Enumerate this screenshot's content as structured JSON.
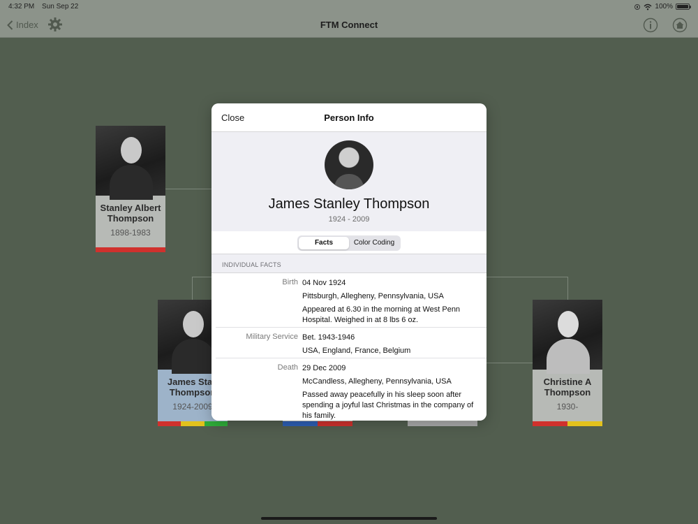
{
  "status": {
    "time": "4:32 PM",
    "date": "Sun Sep 22",
    "battery": "100%"
  },
  "nav": {
    "back_label": "Index",
    "title": "FTM Connect"
  },
  "cards": [
    {
      "first": "Stanley Albert",
      "last": "Thompson",
      "years": "1898-1983",
      "colors": [
        "#d0312d"
      ]
    },
    {
      "first": "James Stan",
      "last": "Thompson",
      "years": "1924-2009",
      "colors": [
        "#d0312d",
        "#e3c21d",
        "#2fae3a"
      ],
      "bg": "#9db3c9"
    },
    {
      "colors": [
        "#2e5fb5",
        "#d0312d"
      ]
    },
    {
      "colors": [
        "#aaaaaa"
      ]
    },
    {
      "first": "Christine A",
      "last": "Thompson",
      "years": "1930-",
      "colors": [
        "#d0312d",
        "#e3c21d"
      ]
    }
  ],
  "modal": {
    "close_label": "Close",
    "title": "Person Info",
    "person_name": "James Stanley Thompson",
    "person_years": "1924 - 2009",
    "tabs": [
      {
        "label": "Facts",
        "active": true
      },
      {
        "label": "Color Coding",
        "active": false
      }
    ],
    "section_header": "INDIVIDUAL FACTS",
    "facts": [
      {
        "label": "Birth",
        "lines": [
          "04 Nov 1924",
          "Pittsburgh, Allegheny, Pennsylvania, USA",
          "Appeared at 6.30 in the morning at West Penn Hospital. Weighed in at 8 lbs 6 oz."
        ]
      },
      {
        "label": "Military Service",
        "lines": [
          "Bet. 1943-1946",
          "USA, England, France, Belgium"
        ]
      },
      {
        "label": "Death",
        "lines": [
          "29 Dec 2009",
          "McCandless, Allegheny, Pennsylvania, USA",
          "Passed away peacefully in his sleep soon after spending a joyful last Christmas in the company of his family."
        ]
      }
    ]
  }
}
